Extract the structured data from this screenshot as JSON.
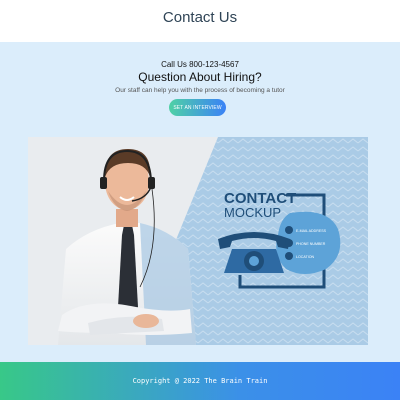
{
  "header": {
    "title": "Contact Us"
  },
  "hero": {
    "call_line": "Call Us 800-123-4567",
    "heading": "Question About Hiring?",
    "subheading": "Our staff can help you with the process of becoming a tutor",
    "cta_label": "SET AN INTERVIEW"
  },
  "banner": {
    "title_line1": "CONTACT",
    "title_line2": "MOCKUP",
    "items": [
      {
        "icon": "email-icon",
        "label": "E-MAIL ADDRESS"
      },
      {
        "icon": "phone-icon",
        "label": "PHONE NUMBER"
      },
      {
        "icon": "location-pin-icon",
        "label": "LOCATION"
      }
    ]
  },
  "footer": {
    "copyright": "Copyright @ 2022 The Brain Train"
  },
  "colors": {
    "hero_bg": "#dbedfb",
    "title_text": "#2f4456",
    "banner_navy": "#1f4e79",
    "gradient_start": "#38c888",
    "gradient_end": "#3b82f6"
  }
}
